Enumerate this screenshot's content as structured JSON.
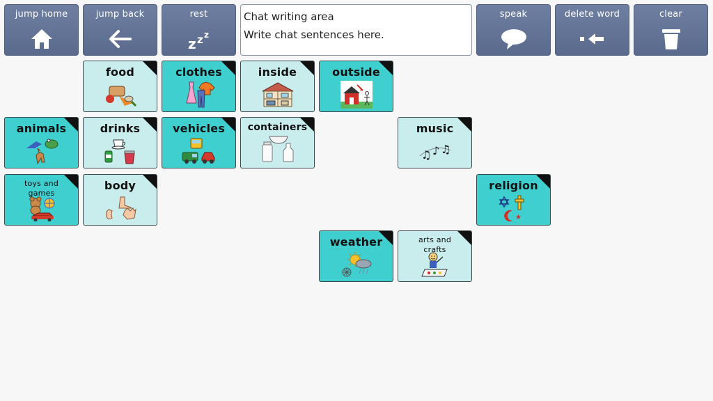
{
  "toolbar": {
    "jump_home": "jump home",
    "jump_back": "jump back",
    "rest": "rest",
    "speak": "speak",
    "delete_word": "delete word",
    "clear": "clear"
  },
  "chat": {
    "title": "Chat writing area",
    "placeholder": "Write chat sentences here."
  },
  "tiles": {
    "food": "food",
    "clothes": "clothes",
    "inside": "inside",
    "outside": "outside",
    "animals": "animals",
    "drinks": "drinks",
    "vehicles": "vehicles",
    "containers": "containers",
    "music": "music",
    "toys_and_games": "toys and games",
    "body": "body",
    "religion": "religion",
    "weather": "weather",
    "arts_and_crafts": "arts and crafts"
  },
  "colors": {
    "toolbar": "#5a6a8c",
    "tile_light": "#c9ecec",
    "tile_dark": "#3fcfce"
  }
}
